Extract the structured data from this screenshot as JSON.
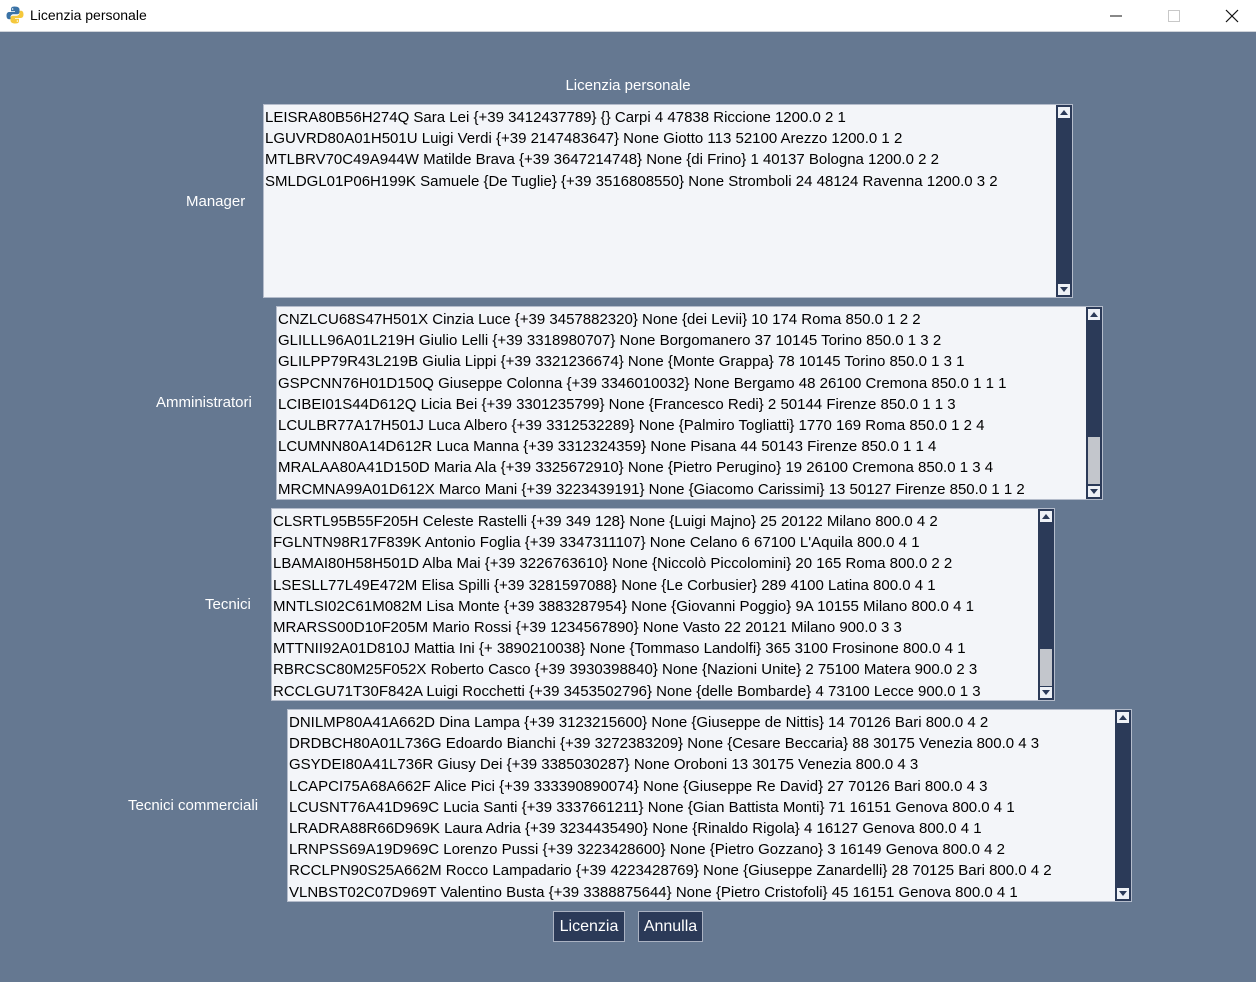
{
  "window": {
    "title": "Licenzia personale",
    "icon": "python-icon",
    "controls": [
      "minimize-icon",
      "maximize-icon",
      "close-icon"
    ]
  },
  "heading": "Licenzia personale",
  "colors": {
    "background": "#657891",
    "scrollbar_track": "#2b3a58",
    "button_background": "#2b3a58",
    "list_background": "#f3f5f9"
  },
  "sections": {
    "manager": {
      "label": "Manager",
      "items": [
        "LEISRA80B56H274Q Sara Lei {+39 3412437789} {} Carpi 4 47838 Riccione 1200.0 2 1",
        "LGUVRD80A01H501U Luigi Verdi {+39 2147483647} None Giotto 113 52100 Arezzo 1200.0 1 2",
        "MTLBRV70C49A944W Matilde Brava {+39 3647214748} None {di Frino} 1 40137 Bologna 1200.0 2 2",
        "SMLDGL01P06H199K Samuele {De Tuglie} {+39 3516808550} None Stromboli 24 48124 Ravenna 1200.0 3 2"
      ]
    },
    "amministratori": {
      "label": "Amministratori",
      "items": [
        "CNZLCU68S47H501X Cinzia Luce {+39 3457882320} None {dei Levii} 10 174 Roma 850.0 1 2 2",
        "GLILLL96A01L219H Giulio Lelli {+39 3318980707} None Borgomanero 37 10145 Torino 850.0 1 3 2",
        "GLILPP79R43L219B Giulia Lippi {+39 3321236674} None {Monte Grappa} 78 10145 Torino 850.0 1 3 1",
        "GSPCNN76H01D150Q Giuseppe Colonna {+39 3346010032} None Bergamo 48 26100 Cremona 850.0 1 1 1",
        "LCIBEI01S44D612Q Licia Bei {+39 3301235799} None {Francesco Redi} 2 50144 Firenze 850.0 1 1 3",
        "LCULBR77A17H501J Luca Albero {+39 3312532289} None {Palmiro Togliatti} 1770 169 Roma 850.0 1 2 4",
        "LCUMNN80A14D612R Luca Manna {+39 3312324359} None Pisana 44 50143 Firenze 850.0 1 1 4",
        "MRALAA80A41D150D Maria Ala {+39 3325672910} None {Pietro Perugino} 19 26100 Cremona 850.0 1 3 4",
        "MRCMNA99A01D612X Marco Mani {+39 3223439191} None {Giacomo Carissimi} 13 50127 Firenze 850.0 1 1 2"
      ]
    },
    "tecnici": {
      "label": "Tecnici",
      "items": [
        "CLSRTL95B55F205H Celeste Rastelli {+39 349 128} None {Luigi Majno} 25 20122 Milano 800.0 4 2",
        "FGLNTN98R17F839K Antonio Foglia {+39 3347311107} None Celano 6 67100 L'Aquila 800.0 4 1",
        "LBAMAI80H58H501D Alba Mai {+39 3226763610} None {Niccolò Piccolomini} 20 165 Roma 800.0 2 2",
        "LSESLL77L49E472M Elisa Spilli {+39 3281597088} None {Le Corbusier} 289 4100 Latina 800.0 4 1",
        "MNTLSI02C61M082M Lisa Monte {+39 3883287954} None {Giovanni Poggio} 9A 10155 Milano 800.0 4 1",
        "MRARSS00D10F205M Mario Rossi {+39 1234567890} None Vasto 22 20121 Milano 900.0 3 3",
        "MTTNII92A01D810J Mattia Ini {+ 3890210038} None {Tommaso Landolfi} 365 3100 Frosinone 800.0 4 1",
        "RBRCSC80M25F052X Roberto Casco {+39 3930398840} None {Nazioni Unite} 2 75100 Matera 900.0 2 3",
        "RCCLGU71T30F842A Luigi Rocchetti {+39 3453502796} None {delle Bombarde} 4 73100 Lecce 900.0 1 3"
      ]
    },
    "tecnici_commerciali": {
      "label": "Tecnici commerciali",
      "items": [
        "DNILMP80A41A662D Dina Lampa {+39 3123215600} None {Giuseppe de Nittis} 14 70126 Bari 800.0 4 2",
        "DRDBCH80A01L736G Edoardo Bianchi {+39 3272383209} None {Cesare Beccaria} 88 30175 Venezia 800.0 4 3",
        "GSYDEI80A41L736R Giusy Dei {+39 3385030287} None Oroboni 13 30175 Venezia 800.0 4 3",
        "LCAPCI75A68A662F Alice Pici {+39 333390890074} None {Giuseppe Re David} 27 70126 Bari 800.0 4 3",
        "LCUSNT76A41D969C Lucia Santi {+39 3337661211} None {Gian Battista Monti} 71 16151 Genova 800.0 4 1",
        "LRADRA88R66D969K Laura Adria {+39 3234435490} None {Rinaldo Rigola} 4 16127 Genova 800.0 4 1",
        "LRNPSS69A19D969C Lorenzo Pussi {+39 3223428600} None {Pietro Gozzano} 3 16149 Genova 800.0 4 2",
        "RCCLPN90S25A662M Rocco Lampadario {+39 4223428769} None {Giuseppe Zanardelli} 28 70125 Bari 800.0 4 2",
        "VLNBST02C07D969T Valentino Busta {+39 3388875644} None {Pietro Cristofoli} 45 16151 Genova 800.0 4 1"
      ]
    }
  },
  "buttons": {
    "licenzia": "Licenzia",
    "annulla": "Annulla"
  }
}
